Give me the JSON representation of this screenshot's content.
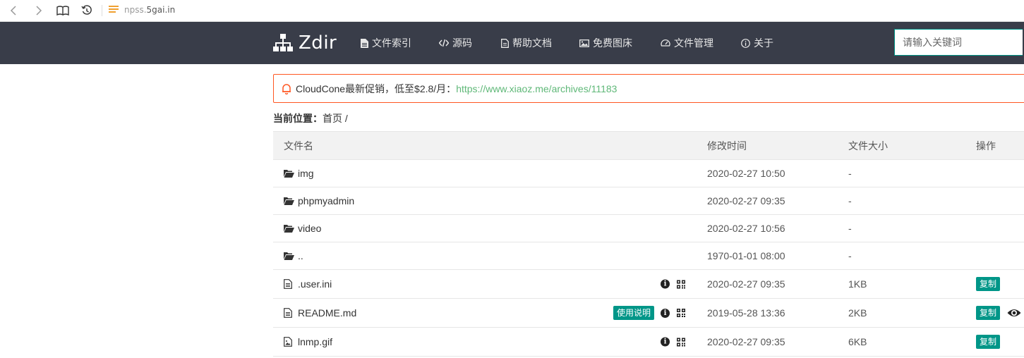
{
  "browser": {
    "url_prefix": "npss.",
    "url_domain": "5gai.in"
  },
  "nav": {
    "brand": "Zdir",
    "items": [
      {
        "label": "文件索引",
        "icon": "file-icon"
      },
      {
        "label": "源码",
        "icon": "code-icon"
      },
      {
        "label": "帮助文档",
        "icon": "document-icon"
      },
      {
        "label": "免费图床",
        "icon": "image-icon"
      },
      {
        "label": "文件管理",
        "icon": "dashboard-icon"
      },
      {
        "label": "关于",
        "icon": "info-icon"
      }
    ],
    "search_placeholder": "请输入关键词"
  },
  "notice": {
    "text": "CloudCone最新促销，低至$2.8/月：",
    "link": "https://www.xiaoz.me/archives/11183",
    "border_color": "#ff5722",
    "link_color": "#5fb878"
  },
  "breadcrumb": {
    "label": "当前位置：",
    "home": "首页",
    "sep": " /"
  },
  "table": {
    "headers": [
      "文件名",
      "修改时间",
      "文件大小",
      "操作"
    ],
    "rows": [
      {
        "type": "folder",
        "name": "img",
        "time": "2020-02-27 10:50",
        "size": "-"
      },
      {
        "type": "folder",
        "name": "phpmyadmin",
        "time": "2020-02-27 09:35",
        "size": "-"
      },
      {
        "type": "folder",
        "name": "video",
        "time": "2020-02-27 10:56",
        "size": "-"
      },
      {
        "type": "folder",
        "name": "..",
        "time": "1970-01-01 08:00",
        "size": "-"
      },
      {
        "type": "file",
        "name": ".user.ini",
        "time": "2020-02-27 09:35",
        "size": "1KB",
        "copy": "复制"
      },
      {
        "type": "file",
        "name": "README.md",
        "time": "2019-05-28 13:36",
        "size": "2KB",
        "copy": "复制",
        "usage": "使用说明",
        "preview": true
      },
      {
        "type": "image",
        "name": "lnmp.gif",
        "time": "2020-02-27 09:35",
        "size": "6KB",
        "copy": "复制"
      }
    ]
  },
  "colors": {
    "nav_bg": "#393d49",
    "accent": "#009688"
  }
}
